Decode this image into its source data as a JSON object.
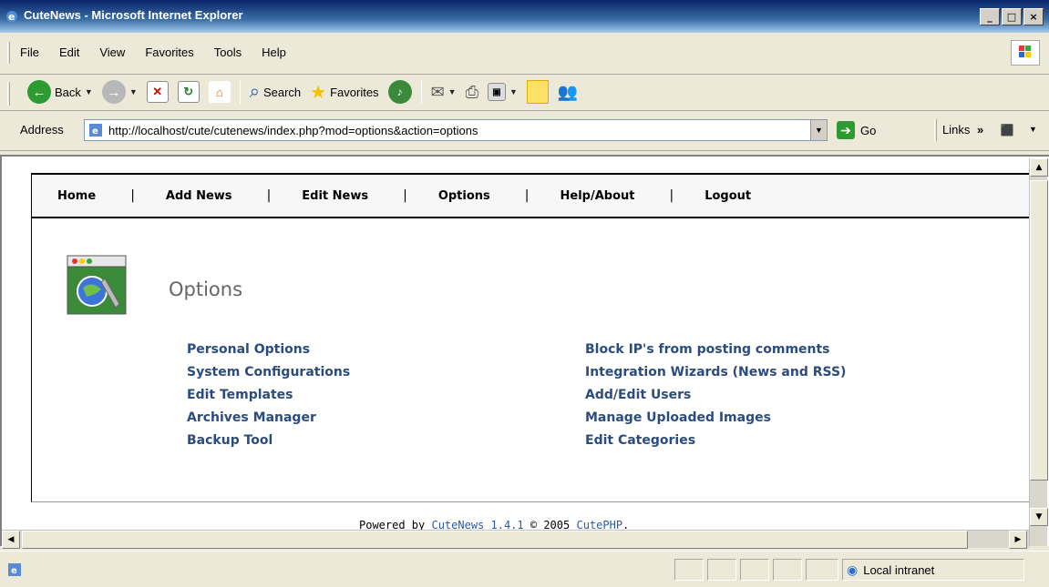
{
  "window": {
    "title": "CuteNews - Microsoft Internet Explorer",
    "buttons": {
      "minimize": "_",
      "maximize": "□",
      "close": "×"
    }
  },
  "menu": {
    "items": [
      "File",
      "Edit",
      "View",
      "Favorites",
      "Tools",
      "Help"
    ]
  },
  "toolbar": {
    "back_label": "Back",
    "search_label": "Search",
    "favorites_label": "Favorites"
  },
  "address_bar": {
    "label": "Address",
    "url": "http://localhost/cute/cutenews/index.php?mod=options&action=options",
    "go_label": "Go",
    "links_label": "Links",
    "links_more": "»"
  },
  "nav": {
    "items": [
      "Home",
      "Add News",
      "Edit News",
      "Options",
      "Help/About",
      "Logout"
    ],
    "separator": "|"
  },
  "options": {
    "title": "Options",
    "left_links": [
      "Personal Options",
      "System Configurations",
      "Edit Templates",
      "Archives Manager",
      "Backup Tool"
    ],
    "right_links": [
      "Block IP's from posting comments",
      "Integration Wizards (News and RSS)",
      "Add/Edit Users",
      "Manage Uploaded Images",
      "Edit Categories"
    ]
  },
  "footer": {
    "powered_by": "Powered by",
    "product_link": "CuteNews 1.4.1",
    "copyright": "© 2005",
    "company_link": "CutePHP",
    "end": "."
  },
  "status_bar": {
    "zone_label": "Local intranet"
  },
  "colors": {
    "title_bar": "#0a246a",
    "link": "#2b4c7e",
    "footer_link": "#2b5aa0",
    "chrome": "#ece9d8"
  }
}
